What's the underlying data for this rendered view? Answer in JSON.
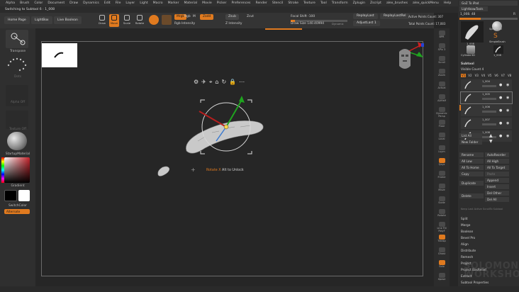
{
  "menu": [
    "Alpha",
    "Brush",
    "Color",
    "Document",
    "Draw",
    "Dynamics",
    "Edit",
    "File",
    "Layer",
    "Light",
    "Macro",
    "Marker",
    "Material",
    "Movie",
    "Picker",
    "Preferences",
    "Render",
    "Stencil",
    "Stroke",
    "Texture",
    "Tool",
    "Transform",
    "Zplugin",
    "Zscript",
    "alex_brushes",
    "alex_quickMenu",
    "Help"
  ],
  "info_text": "Switching to Subtool 6 : 1_008",
  "toolbar": {
    "home_page": "Home Page",
    "lightbox": "LightBox",
    "live_boolean": "Live Boolean",
    "icons": [
      "Draw",
      "Move",
      "Scale",
      "Rotate"
    ],
    "mrgb": "Mrgb",
    "rgb": "Rgb",
    "m": "M",
    "zadd": "Zadd",
    "zsub": "Zsub",
    "zcut": "Zcut",
    "rgb_intensity": "Rgb Intensity",
    "z_intensity": "Z Intensity",
    "focal_shift": "Focal Shift -100",
    "draw_size": "Draw Size 140.40994",
    "dynamic": "Dynamic",
    "replay_last": "ReplayLast",
    "replay_last_rel": "ReplayLastRel",
    "adjust_last": "AdjustLast 1",
    "active_points": "Active Points Count: 307",
    "total_points": "Total Points Count: 17,083",
    "focal_fill": 0.08,
    "draw_fill": 0.38
  },
  "left_shelf": {
    "transpose": "Transpose",
    "dots": "Dots",
    "alpha_off": "Alpha Off",
    "texture_off": "Texture Off",
    "material": "StartupMaterial",
    "gradient": "Gradient",
    "switch_color": "SwitchColor",
    "alternate": "Alternate",
    "colors": {
      "main": "#000000",
      "secondary": "#ffffff",
      "picker_accent": "#c4232b"
    }
  },
  "canvas": {
    "hint_prefix": "Rotate X",
    "hint_suffix": "Alt to Unlock"
  },
  "right_shelf": [
    "BPR",
    "SPix 3",
    "Scroll",
    "Zoom",
    "Actual",
    "AAHalf",
    "Dynamic Persp",
    "Floor",
    "Local",
    "Lsym",
    "Qxyz",
    "Frame",
    "Move",
    "Scale",
    "Rotate",
    "Line Fill PolyF",
    "Transp",
    "Ghost",
    "Solo",
    "Xpose"
  ],
  "palette": {
    "goz": "GoZ To iPad",
    "lightbox_tools": "Lightbox▸Tools",
    "tool_label": "1_008. 48",
    "r": "R",
    "tools": [
      "1_008",
      "Sphere3D",
      "SimpleBrush",
      "Cylinder3D",
      "1_008"
    ],
    "subtool_title": "Subtool",
    "visible_count": "Visible Count 4",
    "v_tabs": [
      "V1",
      "V2",
      "V3",
      "V4",
      "V5",
      "V6",
      "V7",
      "V8"
    ],
    "subtools": [
      "1_004",
      "1_005",
      "1_006",
      "1_007",
      "1_008"
    ],
    "list_all": "List All",
    "new_folder": "New Folder",
    "buttons": [
      [
        "Rename",
        "AutoReorder"
      ],
      [
        "All Low",
        "All High"
      ],
      [
        "All To Home",
        "All To Target"
      ],
      [
        "Copy",
        "Paste"
      ],
      [
        "Duplicate",
        "Append"
      ],
      [
        "",
        "Insert"
      ],
      [
        "Delete",
        "Del Other"
      ],
      [
        "",
        "Del All"
      ]
    ],
    "fast_vis": "Keep Last Active ScrollTo Subtool",
    "menu_items": [
      "Split",
      "Merge",
      "Boolean",
      "Bevel Pro",
      "Align",
      "Distribute",
      "Remesh",
      "Project",
      "Project BasRelief",
      "Extract",
      "Subtool Properties"
    ]
  },
  "watermark": [
    "SOLOMON",
    "WORKSHOP"
  ]
}
